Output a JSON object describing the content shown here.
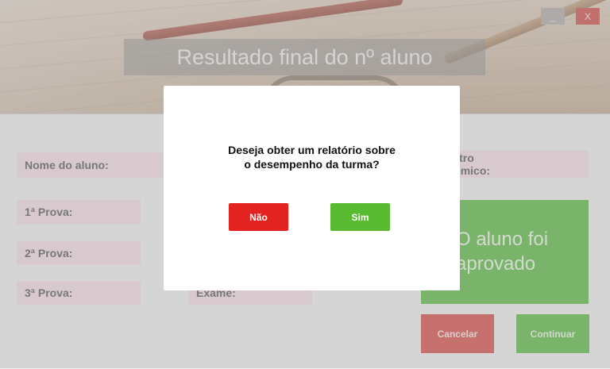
{
  "window": {
    "title": "Resultado final do nº aluno",
    "minimize_label": "_",
    "close_label": "X"
  },
  "form": {
    "nome_label": "Nome do aluno:",
    "prova1_label": "1ª Prova:",
    "prova2_label": "2ª Prova:",
    "prova3_label": "3ª Prova:",
    "exame_label": "Exame:",
    "registro_label_line1": "Registro",
    "registro_label_line2": "acadêmico:",
    "result_line1": "O aluno foi",
    "result_line2": "aprovado",
    "cancel_label": "Cancelar",
    "continue_label": "Continuar"
  },
  "dialog": {
    "question_line1": "Deseja obter um relatório sobre",
    "question_line2": "o desempenho da turma?",
    "no_label": "Não",
    "yes_label": "Sim"
  },
  "colors": {
    "no_button": "#e32320",
    "yes_button": "#58bb31",
    "close_button": "#d0635f",
    "label_background": "#f2dde3"
  }
}
